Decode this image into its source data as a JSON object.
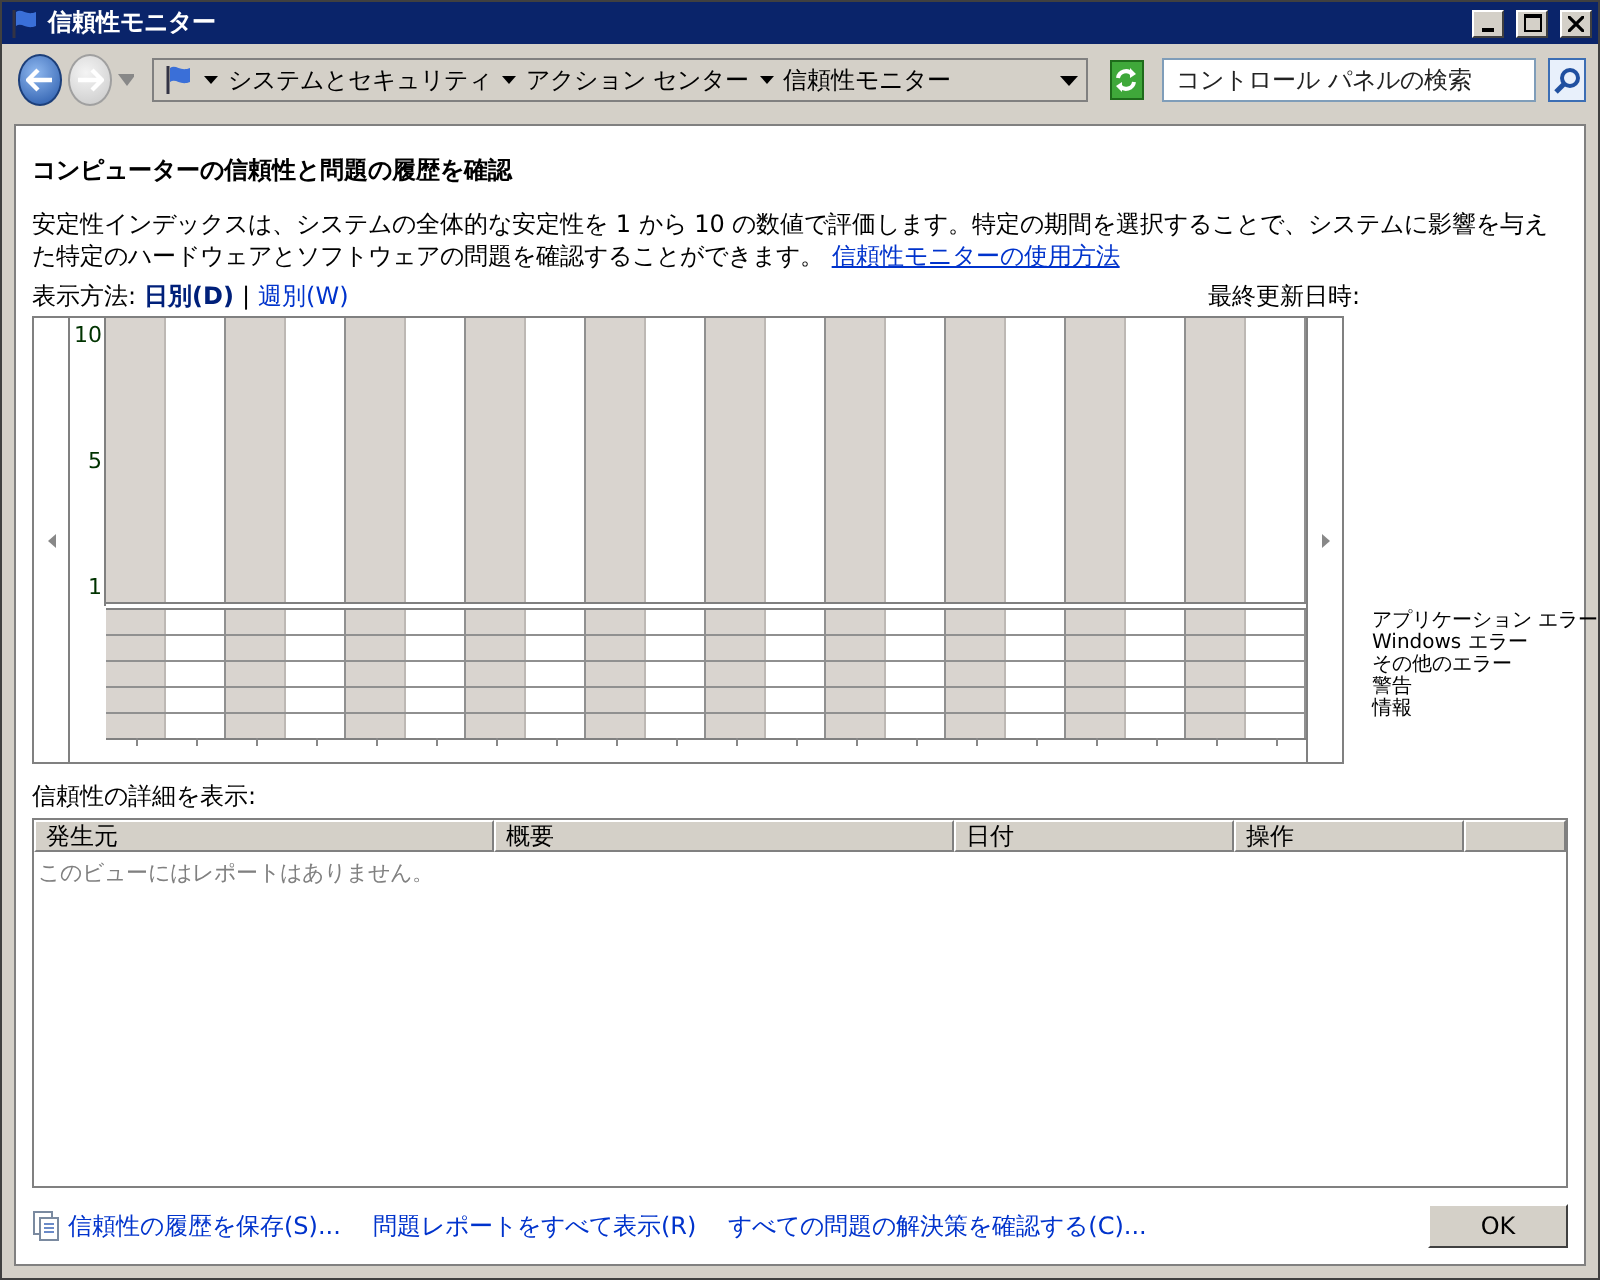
{
  "window": {
    "title": "信頼性モニター"
  },
  "address_bar": {
    "breadcrumbs": [
      "システムとセキュリティ",
      "アクション センター",
      "信頼性モニター"
    ]
  },
  "search": {
    "placeholder": "コントロール パネルの検索"
  },
  "heading": "コンピューターの信頼性と問題の履歴を確認",
  "description": "安定性インデックスは、システムの全体的な安定性を 1 から 10 の数値で評価します。特定の期間を選択することで、システムに影響を与えた特定のハードウェアとソフトウェアの問題を確認することができます。",
  "help_link": "信頼性モニターの使用方法",
  "view": {
    "label": "表示方法:",
    "separator": "|",
    "options": [
      {
        "label": "日別(D)",
        "selected": true
      },
      {
        "label": "週別(W)",
        "selected": false
      }
    ]
  },
  "last_updated": "最終更新日時:",
  "chart": {
    "y_labels": [
      "10",
      "5",
      "1"
    ],
    "legend": [
      "アプリケーション エラー",
      "Windows エラー",
      "その他のエラー",
      "警告",
      "情報"
    ]
  },
  "details": {
    "label": "信頼性の詳細を表示:",
    "columns": [
      "発生元",
      "概要",
      "日付",
      "操作"
    ],
    "empty_message": "このビューにはレポートはありません。"
  },
  "footer_links": [
    "信頼性の履歴を保存(S)...",
    "問題レポートをすべて表示(R)",
    "すべての問題の解決策を確認する(C)..."
  ],
  "ok_button": "OK"
}
